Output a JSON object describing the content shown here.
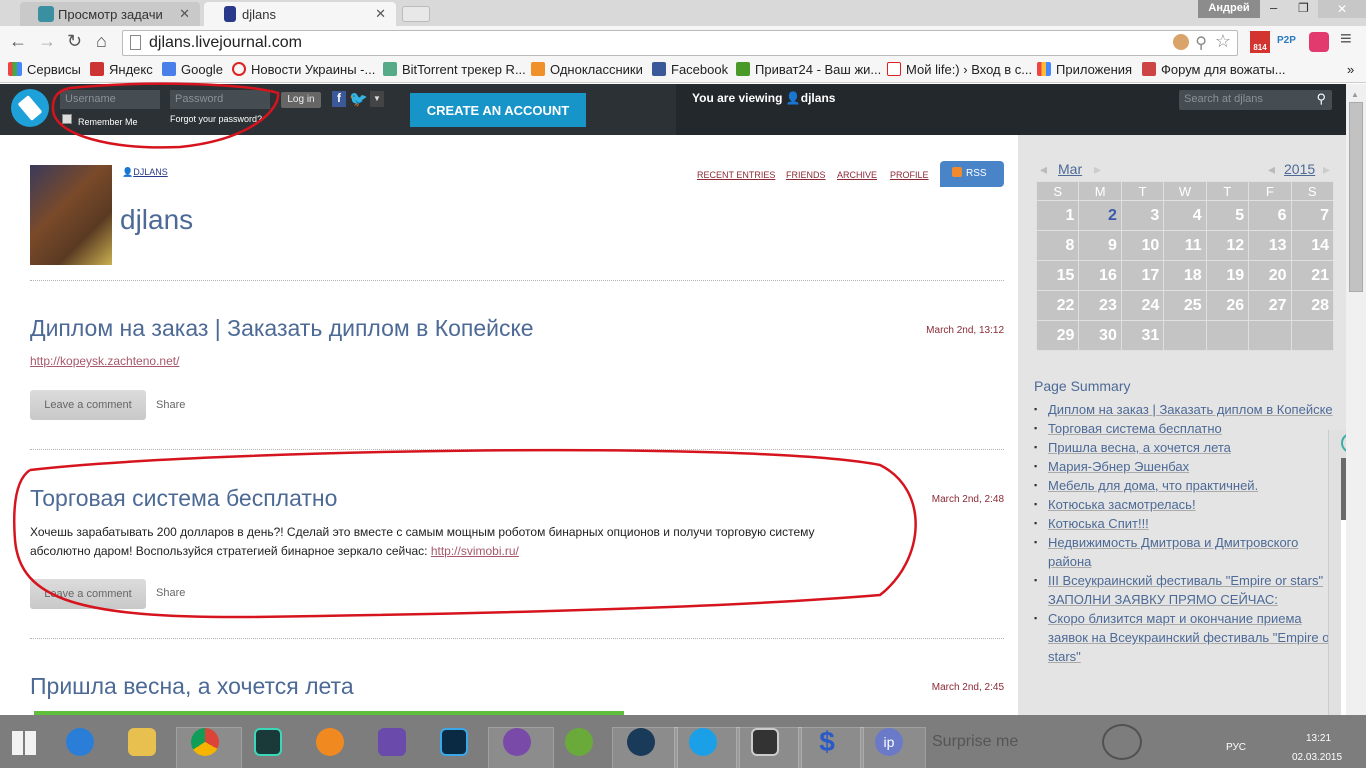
{
  "browser": {
    "tabs": [
      {
        "title": "Просмотр задачи"
      },
      {
        "title": "djlans"
      }
    ],
    "user": "Андрей",
    "url": "djlans.livejournal.com",
    "ext_mail_count": "814",
    "bookmarks": [
      "Сервисы",
      "Яндекс",
      "Google",
      "Новости Украины -...",
      "BitTorrent трекер R...",
      "Одноклассники",
      "Facebook",
      "Приват24 - Ваш жи...",
      "Мой life:) › Вход в с...",
      "Приложения",
      "Форум для вожаты..."
    ],
    "bookmarks_more": "»"
  },
  "ljbar": {
    "username_placeholder": "Username",
    "password_placeholder": "Password",
    "login": "Log in",
    "remember": "Remember Me",
    "forgot": "Forgot your password?",
    "create": "CREATE AN ACCOUNT",
    "viewing_prefix": "You are viewing",
    "viewing_user": "djlans",
    "search_placeholder": "Search at djlans"
  },
  "journal": {
    "user_link": "DJLANS",
    "title": "djlans",
    "nav": [
      "RECENT ENTRIES",
      "FRIENDS",
      "ARCHIVE",
      "PROFILE"
    ],
    "rss": "RSS"
  },
  "posts": [
    {
      "title": "Диплом на заказ | Заказать диплом в Копейске",
      "date": "March 2nd, 13:12",
      "link": "http://kopeysk.zachteno.net/",
      "comment": "Leave a comment",
      "share": "Share"
    },
    {
      "title": "Торговая система бесплатно",
      "date": "March 2nd, 2:48",
      "text1": "Хочешь зарабатывать 200 долларов в день?! Сделай это вместе с самым мощным роботом бинарных опционов и получи торговую систему",
      "text2": "абсолютно даром! Воспользуйся стратегией бинарное зеркало сейчас:",
      "link": "http://svimobi.ru/",
      "comment": "Leave a comment",
      "share": "Share"
    },
    {
      "title": "Пришла весна, а хочется лета",
      "date": "March 2nd, 2:45"
    }
  ],
  "calendar": {
    "month": "Mar",
    "year": "2015",
    "weekdays": [
      "S",
      "M",
      "T",
      "W",
      "T",
      "F",
      "S"
    ],
    "days": 31,
    "first_weekday": 0,
    "highlight": 2
  },
  "summary": {
    "title": "Page Summary",
    "items": [
      "Диплом на заказ | Заказать диплом в Копейске",
      "Торговая система бесплатно",
      "Пришла весна, а хочется лета",
      "Мария-Эбнер Эшенбах",
      "Мебель для дома, что практичней.",
      "Котюська засмотрелась!",
      "Котюська Спит!!!",
      "Недвижимость Дмитрова и Дмитровского района",
      "III Всеукраинский фестиваль \"Empire or stars\" ЗАПОЛНИ ЗАЯВКУ ПРЯМО СЕЙЧАС:",
      "Скоро близится март и окончание приема заявок на Всеукраинский фестиваль \"Empire of stars\""
    ]
  },
  "taskbar": {
    "surprise": "Surprise me",
    "lang": "РУС",
    "time": "13:21",
    "date": "02.03.2015"
  },
  "colors": {
    "accent": "#1795c9",
    "link": "#4d6a96",
    "date": "#8b2a35",
    "annotation": "#d6141e"
  }
}
